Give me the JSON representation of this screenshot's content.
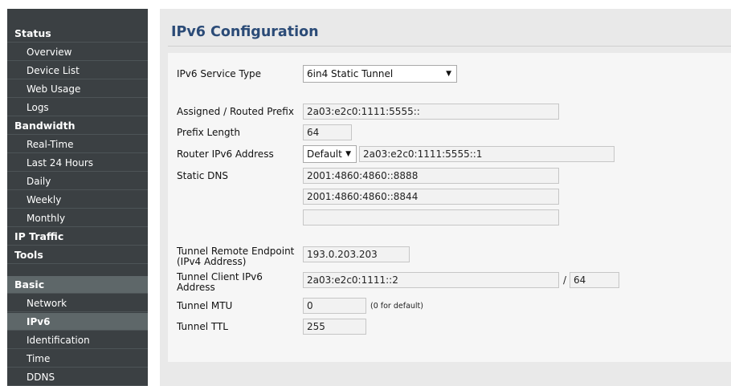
{
  "sidebar": {
    "items": [
      {
        "label": "Status",
        "kind": "sec"
      },
      {
        "label": "Overview",
        "kind": "sub"
      },
      {
        "label": "Device List",
        "kind": "sub"
      },
      {
        "label": "Web Usage",
        "kind": "sub"
      },
      {
        "label": "Logs",
        "kind": "sub"
      },
      {
        "label": "Bandwidth",
        "kind": "sec"
      },
      {
        "label": "Real-Time",
        "kind": "sub"
      },
      {
        "label": "Last 24 Hours",
        "kind": "sub"
      },
      {
        "label": "Daily",
        "kind": "sub"
      },
      {
        "label": "Weekly",
        "kind": "sub"
      },
      {
        "label": "Monthly",
        "kind": "sub"
      },
      {
        "label": "IP Traffic",
        "kind": "sec"
      },
      {
        "label": "Tools",
        "kind": "sec"
      },
      {
        "label": "Basic",
        "kind": "sec"
      },
      {
        "label": "Network",
        "kind": "sub"
      },
      {
        "label": "IPv6",
        "kind": "sub",
        "active": true
      },
      {
        "label": "Identification",
        "kind": "sub"
      },
      {
        "label": "Time",
        "kind": "sub"
      },
      {
        "label": "DDNS",
        "kind": "sub"
      }
    ]
  },
  "main": {
    "title": "IPv6 Configuration",
    "service_type": {
      "label": "IPv6 Service Type",
      "value": "6in4 Static Tunnel"
    },
    "prefix": {
      "label": "Assigned / Routed Prefix",
      "value": "2a03:e2c0:1111:5555::"
    },
    "prefix_length": {
      "label": "Prefix Length",
      "value": "64"
    },
    "router_address": {
      "label": "Router IPv6 Address",
      "mode": "Default",
      "value": "2a03:e2c0:1111:5555::1"
    },
    "static_dns": {
      "label": "Static DNS",
      "values": [
        "2001:4860:4860::8888",
        "2001:4860:4860::8844",
        ""
      ]
    },
    "remote_endpoint": {
      "label_line1": "Tunnel Remote Endpoint",
      "label_line2": "(IPv4 Address)",
      "value": "193.0.203.203"
    },
    "client_address": {
      "label_line1": "Tunnel Client IPv6",
      "label_line2": "Address",
      "value": "2a03:e2c0:1111::2",
      "slash": "/",
      "prefix": "64"
    },
    "mtu": {
      "label": "Tunnel MTU",
      "value": "0",
      "hint": "(0 for default)"
    },
    "ttl": {
      "label": "Tunnel TTL",
      "value": "255"
    }
  },
  "colors": {
    "sidebar_bg": "#3b4043",
    "active_bg": "#5e6769",
    "title": "#2b4b77",
    "panel_bg": "#e9e9e9",
    "form_bg": "#f6f6f6"
  }
}
